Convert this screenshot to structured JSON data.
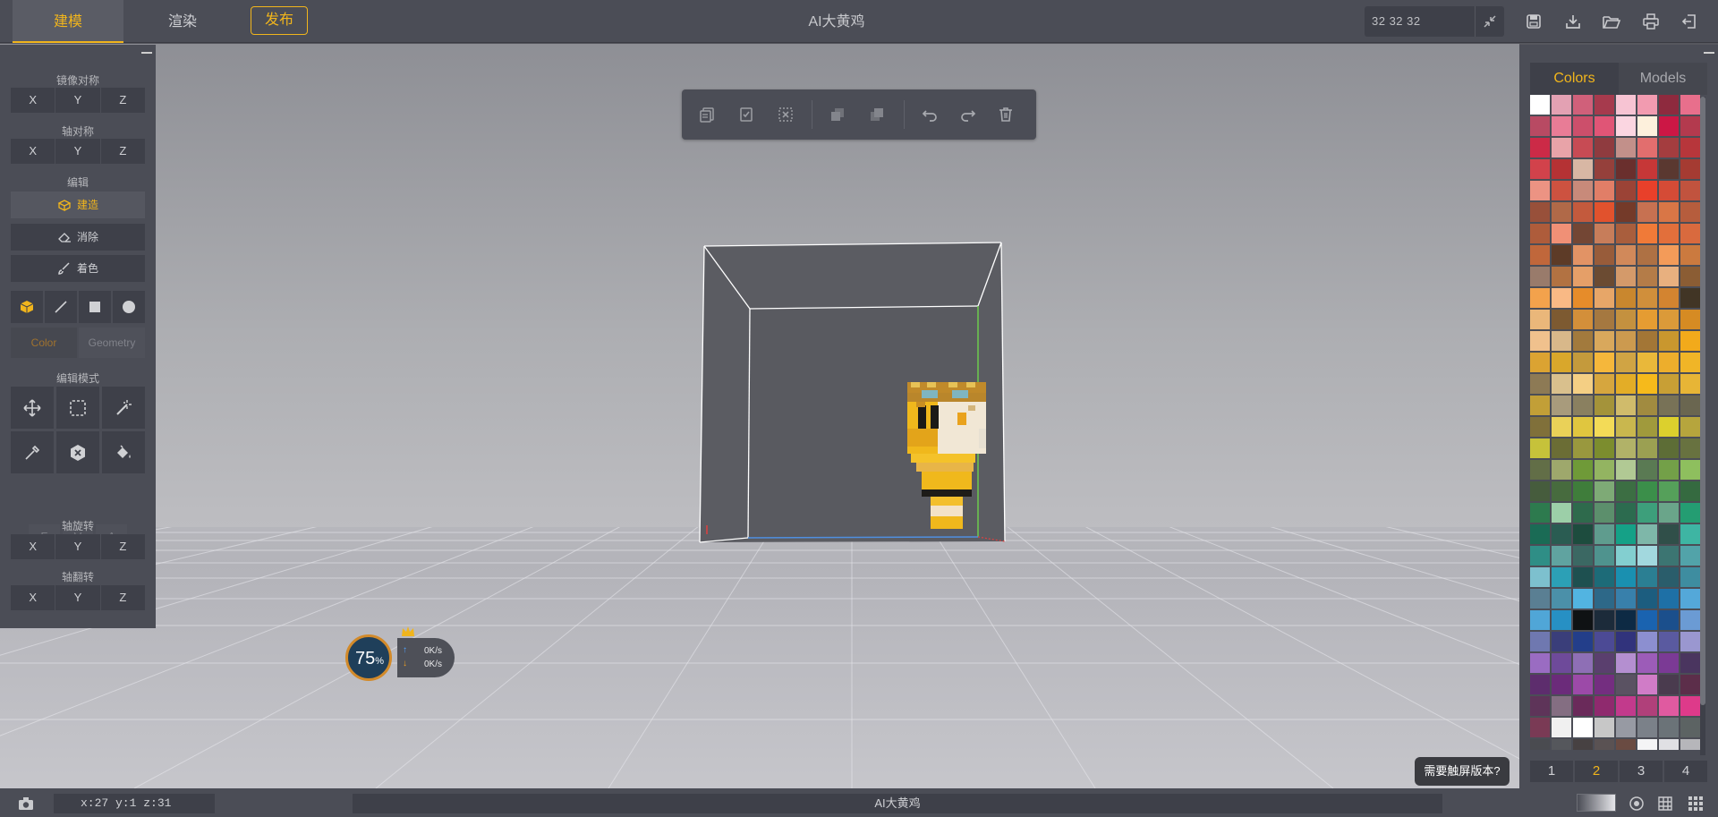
{
  "topbar": {
    "tabs": [
      {
        "label": "建模"
      },
      {
        "label": "渲染"
      }
    ],
    "publish_label": "发布",
    "title": "AI大黄鸡",
    "dims": "32  32  32"
  },
  "left_panel": {
    "mirror_title": "镜像对称",
    "axis_sym_title": "轴对称",
    "edit_title": "编辑",
    "build_label": "建造",
    "erase_label": "消除",
    "paint_label": "着色",
    "color_label": "Color",
    "geometry_label": "Geometry",
    "edit_mode_title": "编辑模式",
    "fva": [
      "F",
      "V",
      "A"
    ],
    "rotate_title": "轴旋转",
    "flip_title": "轴翻转",
    "axes": [
      "X",
      "Y",
      "Z"
    ]
  },
  "net_widget": {
    "percent": "75",
    "percent_unit": "%",
    "up": "0K/s",
    "down": "0K/s"
  },
  "touch_popup": "需要触屏版本?",
  "right_panel": {
    "tabs": [
      {
        "label": "Colors"
      },
      {
        "label": "Models"
      }
    ],
    "pages": [
      "1",
      "2",
      "3",
      "4"
    ],
    "active_page": "2"
  },
  "palette": [
    [
      "#ffffff",
      "#e3a1b3",
      "#d0607a",
      "#a63a4d",
      "#f7c4d3",
      "#f29bb0",
      "#8e2a3e",
      "#e86f8c"
    ],
    [
      "#b84a63",
      "#e87c96",
      "#cc4f6b",
      "#e05576",
      "#fbd6e1",
      "#fdf0dc",
      "#cc1745",
      "#b33a4e"
    ],
    [
      "#cc2a47",
      "#e8a3a8",
      "#c74b54",
      "#8f3b3f",
      "#c2908a",
      "#e26e6e",
      "#a43d3f",
      "#b7363b"
    ],
    [
      "#d2424b",
      "#b53234",
      "#d8b7a4",
      "#95403b",
      "#6a2f2d",
      "#c63737",
      "#5a3830",
      "#a53b32"
    ],
    [
      "#ec9383",
      "#cd5240",
      "#c88a7a",
      "#e17e67",
      "#9b4336",
      "#e8402a",
      "#d54b36",
      "#c1533e"
    ],
    [
      "#98503a",
      "#b06948",
      "#c35a3d",
      "#e1522d",
      "#743a29",
      "#c77151",
      "#d97646",
      "#b65d3d"
    ],
    [
      "#ae5c3b",
      "#f09076",
      "#734634",
      "#c77d5a",
      "#a95e3d",
      "#f07a38",
      "#e26f3b",
      "#d96a3e"
    ],
    [
      "#c0673b",
      "#5d3b27",
      "#e29365",
      "#985c3a",
      "#d1895a",
      "#ae7144",
      "#f39b59",
      "#cb7a3f"
    ],
    [
      "#997b6b",
      "#b27242",
      "#e59f68",
      "#6b4b32",
      "#d49a6a",
      "#b47c48",
      "#e8b07f",
      "#8b5d34"
    ],
    [
      "#f3a24c",
      "#f9b985",
      "#e68c2a",
      "#e7a668",
      "#c9872e",
      "#d08f3b",
      "#d38430",
      "#413525"
    ],
    [
      "#eab77a",
      "#7d5a31",
      "#d38f3a",
      "#a57840",
      "#c4913f",
      "#e59c32",
      "#db9a39",
      "#d68b23"
    ],
    [
      "#f0c18d",
      "#d8b88a",
      "#a27a3d",
      "#d9a85c",
      "#cc9a4f",
      "#a37636",
      "#c9972e",
      "#f2aa1b"
    ],
    [
      "#dba332",
      "#d9a72b",
      "#c49a3c",
      "#f5b73b",
      "#d0a444",
      "#e9b83a",
      "#edae2c",
      "#f0b527"
    ],
    [
      "#8d7a55",
      "#d9c08d",
      "#f4cf84",
      "#d6a63e",
      "#e3ad27",
      "#f6ba1b",
      "#c89f35",
      "#e7b536"
    ],
    [
      "#c29f37",
      "#a89b7c",
      "#8a8060",
      "#a4933a",
      "#d0bb6b",
      "#a18b40",
      "#787257",
      "#6a6650"
    ],
    [
      "#80703a",
      "#ead158",
      "#e0c63f",
      "#f3db57",
      "#c9b74e",
      "#a09a3c",
      "#dcd02d",
      "#b6a53d"
    ],
    [
      "#c6c23a",
      "#6b6d35",
      "#99983e",
      "#7c8d2e",
      "#b1b268",
      "#9ba052",
      "#5d6d36",
      "#687240"
    ],
    [
      "#626e47",
      "#9ea86c",
      "#6f9a38",
      "#93b461",
      "#b1c994",
      "#5a7a53",
      "#73a048",
      "#8ebf5e"
    ],
    [
      "#465c3d",
      "#476b3e",
      "#3f7d3b",
      "#7eaa76",
      "#3c6e43",
      "#3b8f4a",
      "#55a05a",
      "#356a40"
    ],
    [
      "#2d7a4e",
      "#9ccfa8",
      "#2e6a4c",
      "#5c8f6c",
      "#2c6b4f",
      "#3d9f7b",
      "#6aa58a",
      "#249d72"
    ],
    [
      "#1a6b55",
      "#2a5c52",
      "#1d4c3e",
      "#5f9c8e",
      "#15a187",
      "#7eb7a9",
      "#304f49",
      "#3eb5a3"
    ],
    [
      "#2f8e86",
      "#60a3a0",
      "#3b6863",
      "#4f938e",
      "#83cfd0",
      "#a2d8de",
      "#3c7572",
      "#52a3a9"
    ],
    [
      "#7dc0ce",
      "#2ca0b6",
      "#1e5050",
      "#1d6b78",
      "#1a90b0",
      "#2b7f93",
      "#2a5d6b",
      "#3e8da0"
    ],
    [
      "#5a7f93",
      "#4b90a9",
      "#52b4e1",
      "#2d6888",
      "#3880ab",
      "#1c5d7f",
      "#1e70a6",
      "#54a8d9"
    ],
    [
      "#50a6d7",
      "#2790c4",
      "#0f1214",
      "#1c2b3a",
      "#0d2a44",
      "#1a63b0",
      "#1b4f8c",
      "#6b9bd4"
    ],
    [
      "#6f78b0",
      "#3a3e7a",
      "#233e8a",
      "#4c4a95",
      "#31337c",
      "#8c8fd0",
      "#5a5aa0",
      "#9a97d0"
    ],
    [
      "#9a6cc2",
      "#6e4a9a",
      "#8e6fb5",
      "#5a3f6e",
      "#b48fd0",
      "#9c5cb8",
      "#7b3a95",
      "#4a355f"
    ],
    [
      "#5d2d6d",
      "#6b2b7a",
      "#9c4aa8",
      "#742e80",
      "#5a5262",
      "#d07cc7",
      "#4a3b4e",
      "#5c2e4a"
    ],
    [
      "#5e3459",
      "#846e82",
      "#6a2a5a",
      "#8f2a6e",
      "#c23a8c",
      "#b0407a",
      "#e05aa0",
      "#de3a8a"
    ],
    [
      "#7a3a55",
      "#f0f0f0",
      "#ffffff",
      "#c7c7c7",
      "#979aa3",
      "#7b8189",
      "#6b7378",
      "#5c6363"
    ],
    [
      "#4a4b50",
      "#55575c",
      "#474142",
      "#5a5253",
      "#6a4b42",
      "#f4f4f6",
      "#e0e0e4",
      "#b6b6ba"
    ]
  ],
  "bottombar": {
    "coord": "x:27 y:1  z:31",
    "status_title": "AI大黄鸡"
  }
}
